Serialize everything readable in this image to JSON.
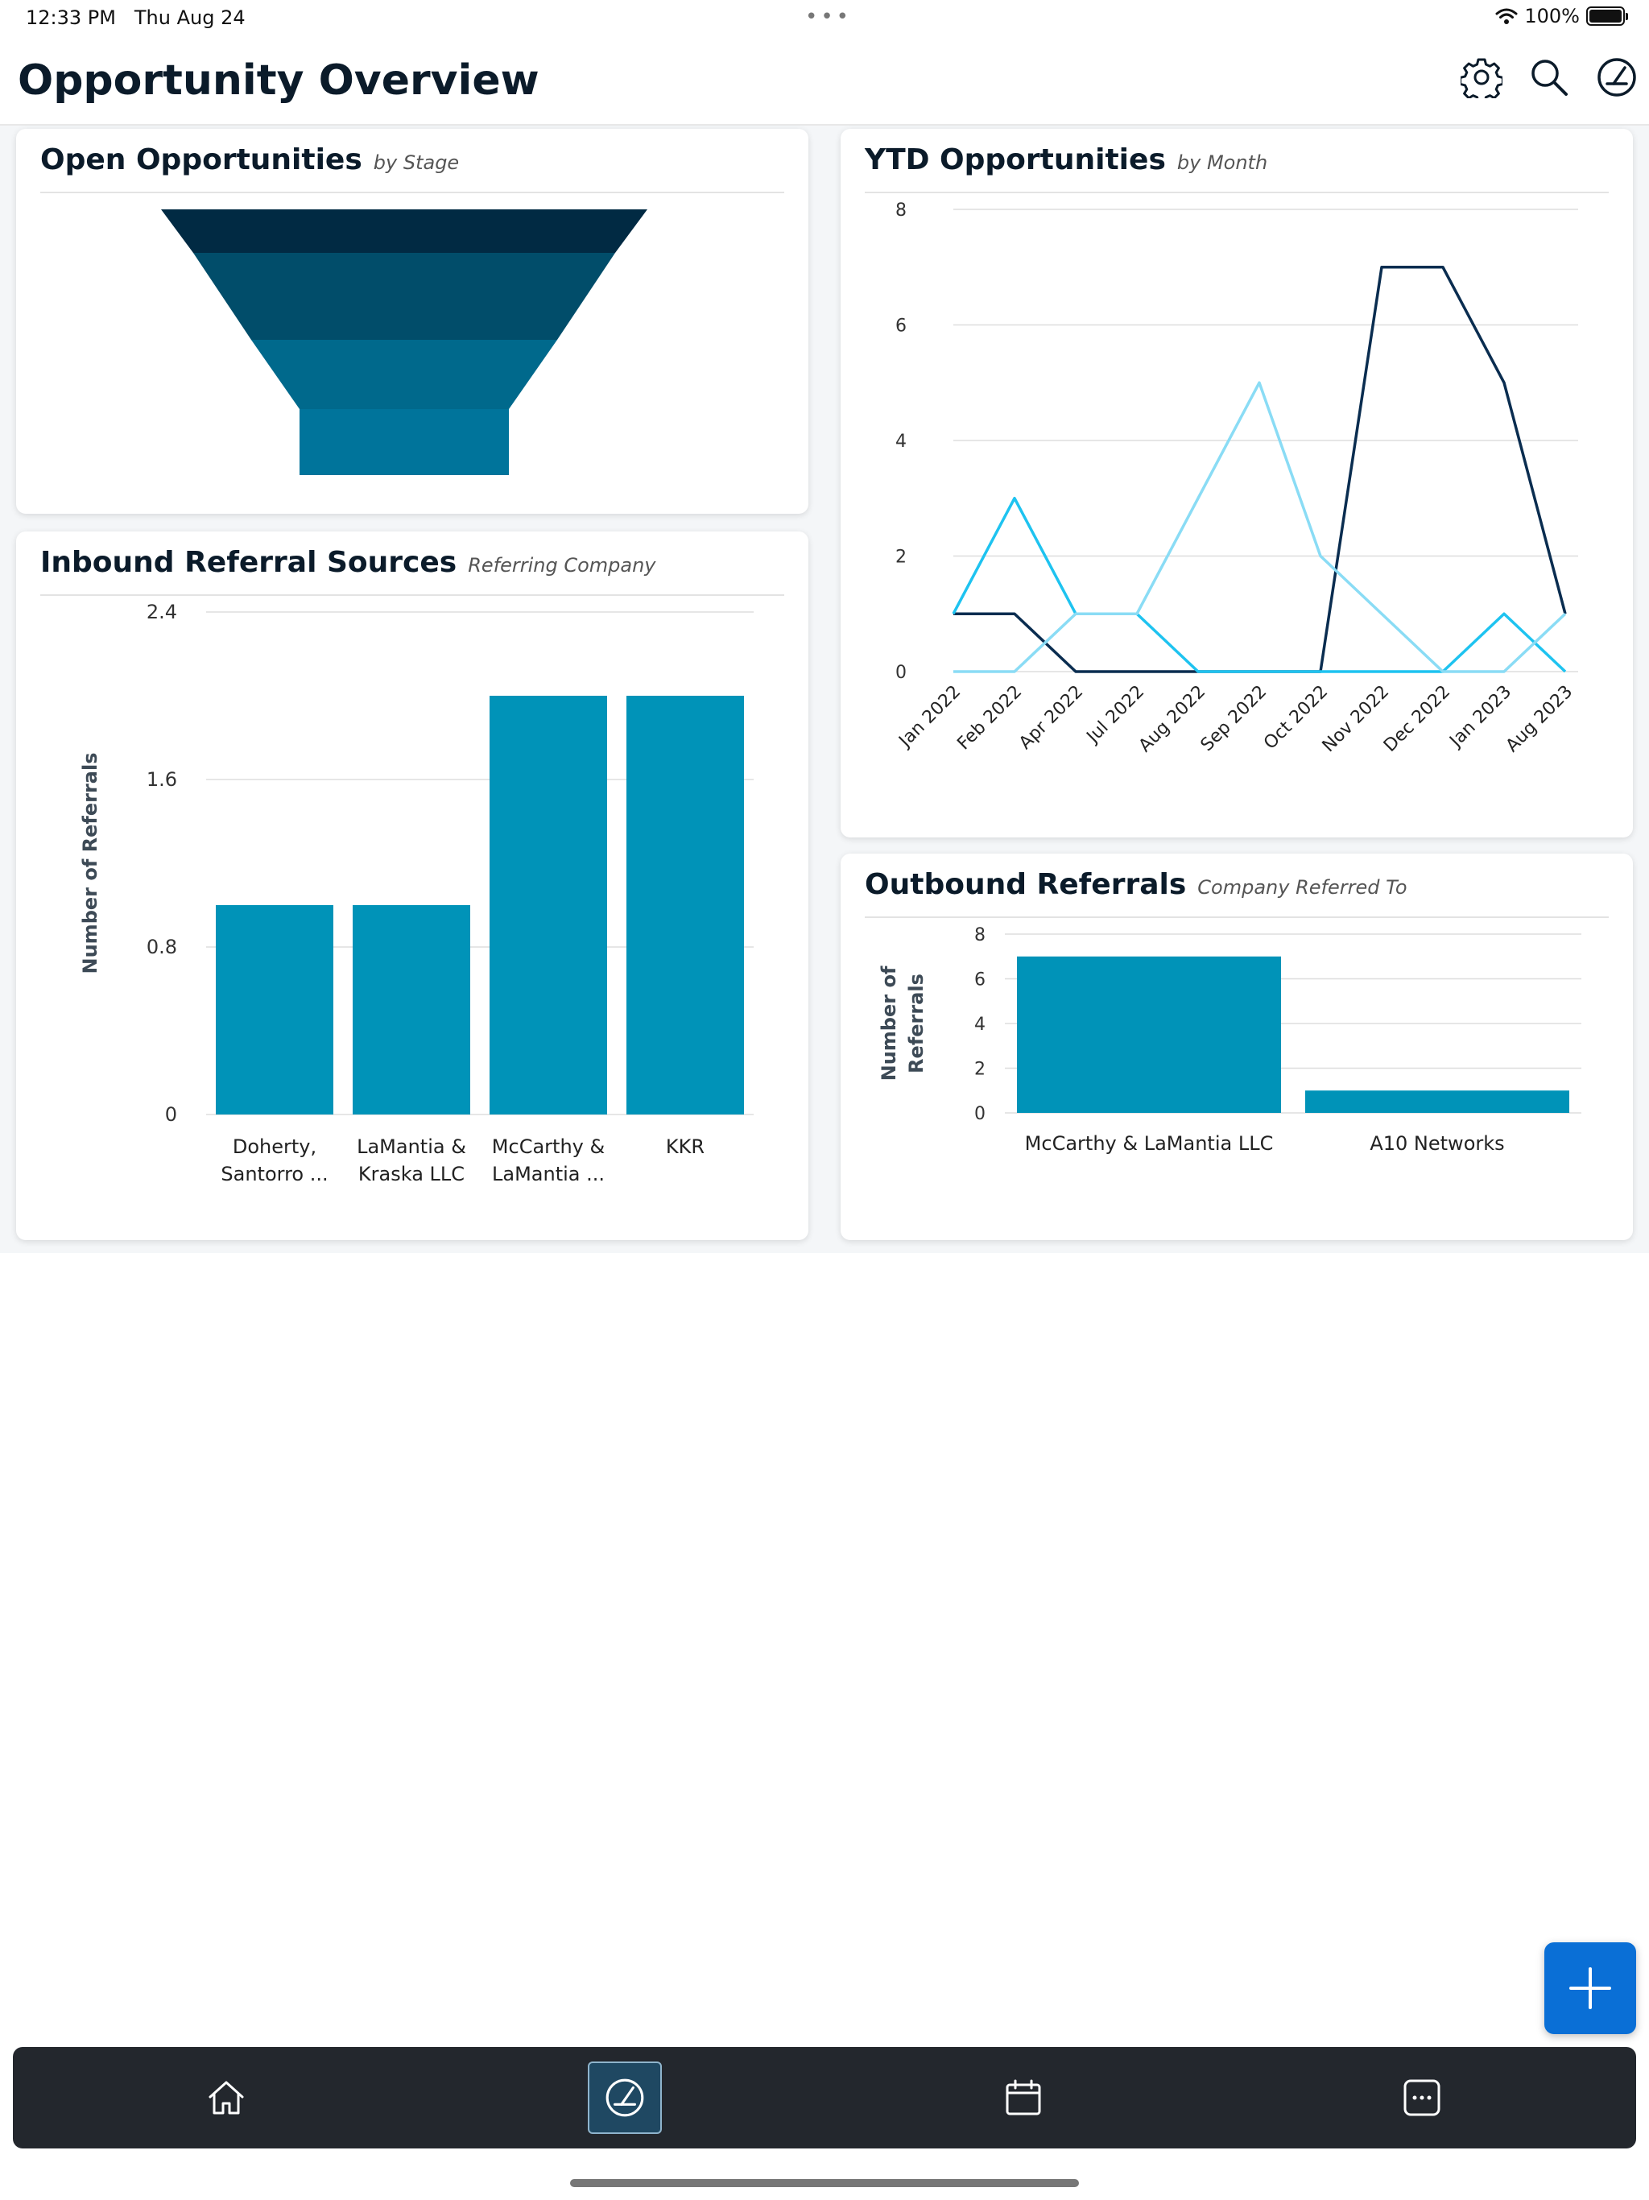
{
  "status": {
    "time": "12:33 PM",
    "date": "Thu Aug 24",
    "battery": "100%"
  },
  "header": {
    "title": "Opportunity Overview",
    "icons": [
      "gear-icon",
      "search-icon",
      "dashboard-icon"
    ]
  },
  "cards": {
    "open_opportunities": {
      "title": "Open Opportunities",
      "subtitle": "by Stage"
    },
    "inbound": {
      "title": "Inbound Referral Sources",
      "subtitle": "Referring Company"
    },
    "ytd": {
      "title": "YTD Opportunities",
      "subtitle": "by Month"
    },
    "outbound": {
      "title": "Outbound Referrals",
      "subtitle": "Company Referred To"
    }
  },
  "chart_data": [
    {
      "id": "open_opportunities",
      "type": "funnel",
      "stages": 4,
      "colors": [
        "#012a43",
        "#014d6a",
        "#00698c",
        "#00749b"
      ]
    },
    {
      "id": "inbound",
      "type": "bar",
      "categories": [
        [
          "Doherty,",
          "Santorro ..."
        ],
        [
          "LaMantia &",
          "Kraska LLC"
        ],
        [
          "McCarthy &",
          "LaMantia ..."
        ],
        [
          "KKR"
        ]
      ],
      "values": [
        1,
        1,
        2,
        2
      ],
      "ylabel": "Number of Referrals",
      "yticks": [
        "0",
        "0.8",
        "1.6",
        "2.4"
      ],
      "ylim": [
        0,
        2.4
      ],
      "color": "#0093b8"
    },
    {
      "id": "ytd",
      "type": "line",
      "categories": [
        "Jan 2022",
        "Feb 2022",
        "Apr 2022",
        "Jul 2022",
        "Aug 2022",
        "Sep 2022",
        "Oct 2022",
        "Nov 2022",
        "Dec 2022",
        "Jan 2023",
        "Aug 2023"
      ],
      "yticks": [
        "0",
        "2",
        "4",
        "6",
        "8"
      ],
      "ylim": [
        0,
        8
      ],
      "series": [
        {
          "color": "#0a2d50",
          "values": [
            1,
            1,
            0,
            0,
            0,
            0,
            0,
            7,
            7,
            5,
            1
          ]
        },
        {
          "color": "#1ec3f0",
          "values": [
            1,
            3,
            1,
            1,
            0,
            0,
            0,
            0,
            0,
            1,
            0
          ]
        },
        {
          "color": "#8adcf5",
          "values": [
            0,
            0,
            1,
            1,
            3,
            5,
            2,
            1,
            0,
            0,
            1
          ]
        }
      ]
    },
    {
      "id": "outbound",
      "type": "bar",
      "categories": [
        "McCarthy & LaMantia LLC",
        "A10 Networks"
      ],
      "values": [
        7,
        1
      ],
      "ylabel": [
        "Number of",
        "Referrals"
      ],
      "yticks": [
        "0",
        "2",
        "4",
        "6",
        "8"
      ],
      "ylim": [
        0,
        8
      ],
      "color": "#0093b8"
    }
  ],
  "tabbar": {
    "tabs": [
      {
        "name": "home-icon",
        "active": false
      },
      {
        "name": "dashboard-icon",
        "active": true
      },
      {
        "name": "calendar-icon",
        "active": false
      },
      {
        "name": "more-icon",
        "active": false
      }
    ]
  },
  "fab": {
    "icon": "plus-icon"
  }
}
